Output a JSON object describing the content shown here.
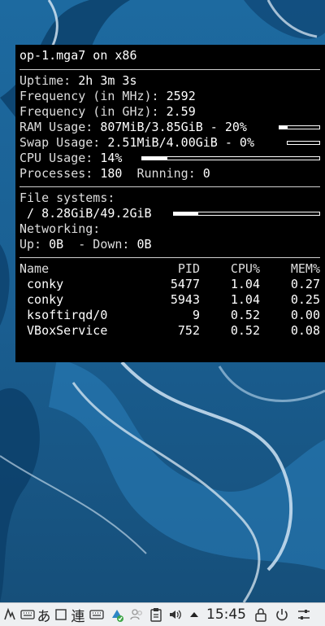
{
  "conky": {
    "title": "op-1.mga7 on x86",
    "uptime_label": "Uptime:",
    "uptime_value": "2h 3m 3s",
    "freq_mhz_label": "Frequency (in MHz):",
    "freq_mhz_value": "2592",
    "freq_ghz_label": "Frequency (in GHz):",
    "freq_ghz_value": "2.59",
    "ram_label": "RAM Usage:",
    "ram_value": "807MiB/3.85GiB - 20%",
    "ram_percent": 20,
    "swap_label": "Swap Usage:",
    "swap_value": "2.51MiB/4.00GiB - 0%",
    "swap_percent": 0,
    "cpu_label": "CPU Usage:",
    "cpu_value": "14%",
    "cpu_percent": 14,
    "processes_label": "Processes:",
    "processes_value": "180",
    "running_label": "Running:",
    "running_value": "0",
    "fs_label": "File systems:",
    "fs_root": "/ 8.28GiB/49.2GiB",
    "fs_percent": 17,
    "net_label": "Networking:",
    "up_label": "Up:",
    "up_value": "0B",
    "down_label": "- Down:",
    "down_value": "0B",
    "proc_headers": [
      "Name",
      "PID",
      "CPU%",
      "MEM%"
    ],
    "processes": [
      {
        "name": "conky",
        "pid": "5477",
        "cpu": "1.04",
        "mem": "0.27"
      },
      {
        "name": "conky",
        "pid": "5943",
        "cpu": "1.04",
        "mem": "0.25"
      },
      {
        "name": "ksoftirqd/0",
        "pid": "9",
        "cpu": "0.52",
        "mem": "0.00"
      },
      {
        "name": "VBoxService",
        "pid": "752",
        "cpu": "0.52",
        "mem": "0.08"
      }
    ]
  },
  "taskbar": {
    "ime_hiragana": "あ",
    "ime_kanji": "連",
    "clock": "15:45"
  }
}
